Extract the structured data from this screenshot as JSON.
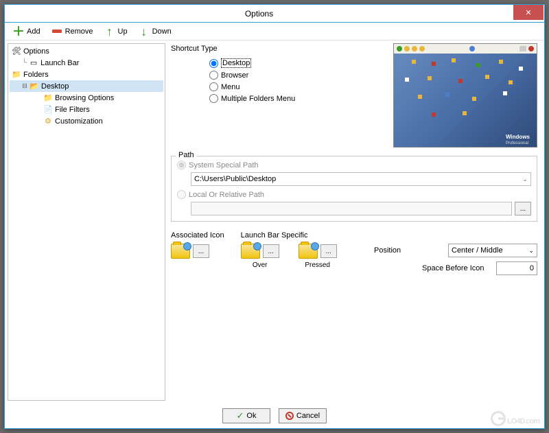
{
  "window": {
    "title": "Options"
  },
  "toolbar": {
    "add": "Add",
    "remove": "Remove",
    "up": "Up",
    "down": "Down"
  },
  "tree": {
    "options": "Options",
    "launch_bar": "Launch Bar",
    "folders": "Folders",
    "desktop": "Desktop",
    "browsing_options": "Browsing Options",
    "file_filters": "File Filters",
    "customization": "Customization"
  },
  "shortcut": {
    "title": "Shortcut Type",
    "desktop": "Desktop",
    "browser": "Browser",
    "menu": "Menu",
    "multiple": "Multiple Folders Menu"
  },
  "preview": {
    "logo": "Windows",
    "logo_sub": "Professional"
  },
  "path": {
    "legend": "Path",
    "system": "System Special Path",
    "value": "C:\\Users\\Public\\Desktop",
    "local": "Local Or Relative Path",
    "browse": "..."
  },
  "icons": {
    "associated": "Associated Icon",
    "launchbar": "Launch Bar Specific",
    "over": "Over",
    "pressed": "Pressed",
    "browse": "..."
  },
  "position": {
    "label": "Position",
    "value": "Center / Middle",
    "space_label": "Space Before Icon",
    "space_value": "0"
  },
  "footer": {
    "ok": "Ok",
    "cancel": "Cancel"
  },
  "watermark": "LO4D.com"
}
